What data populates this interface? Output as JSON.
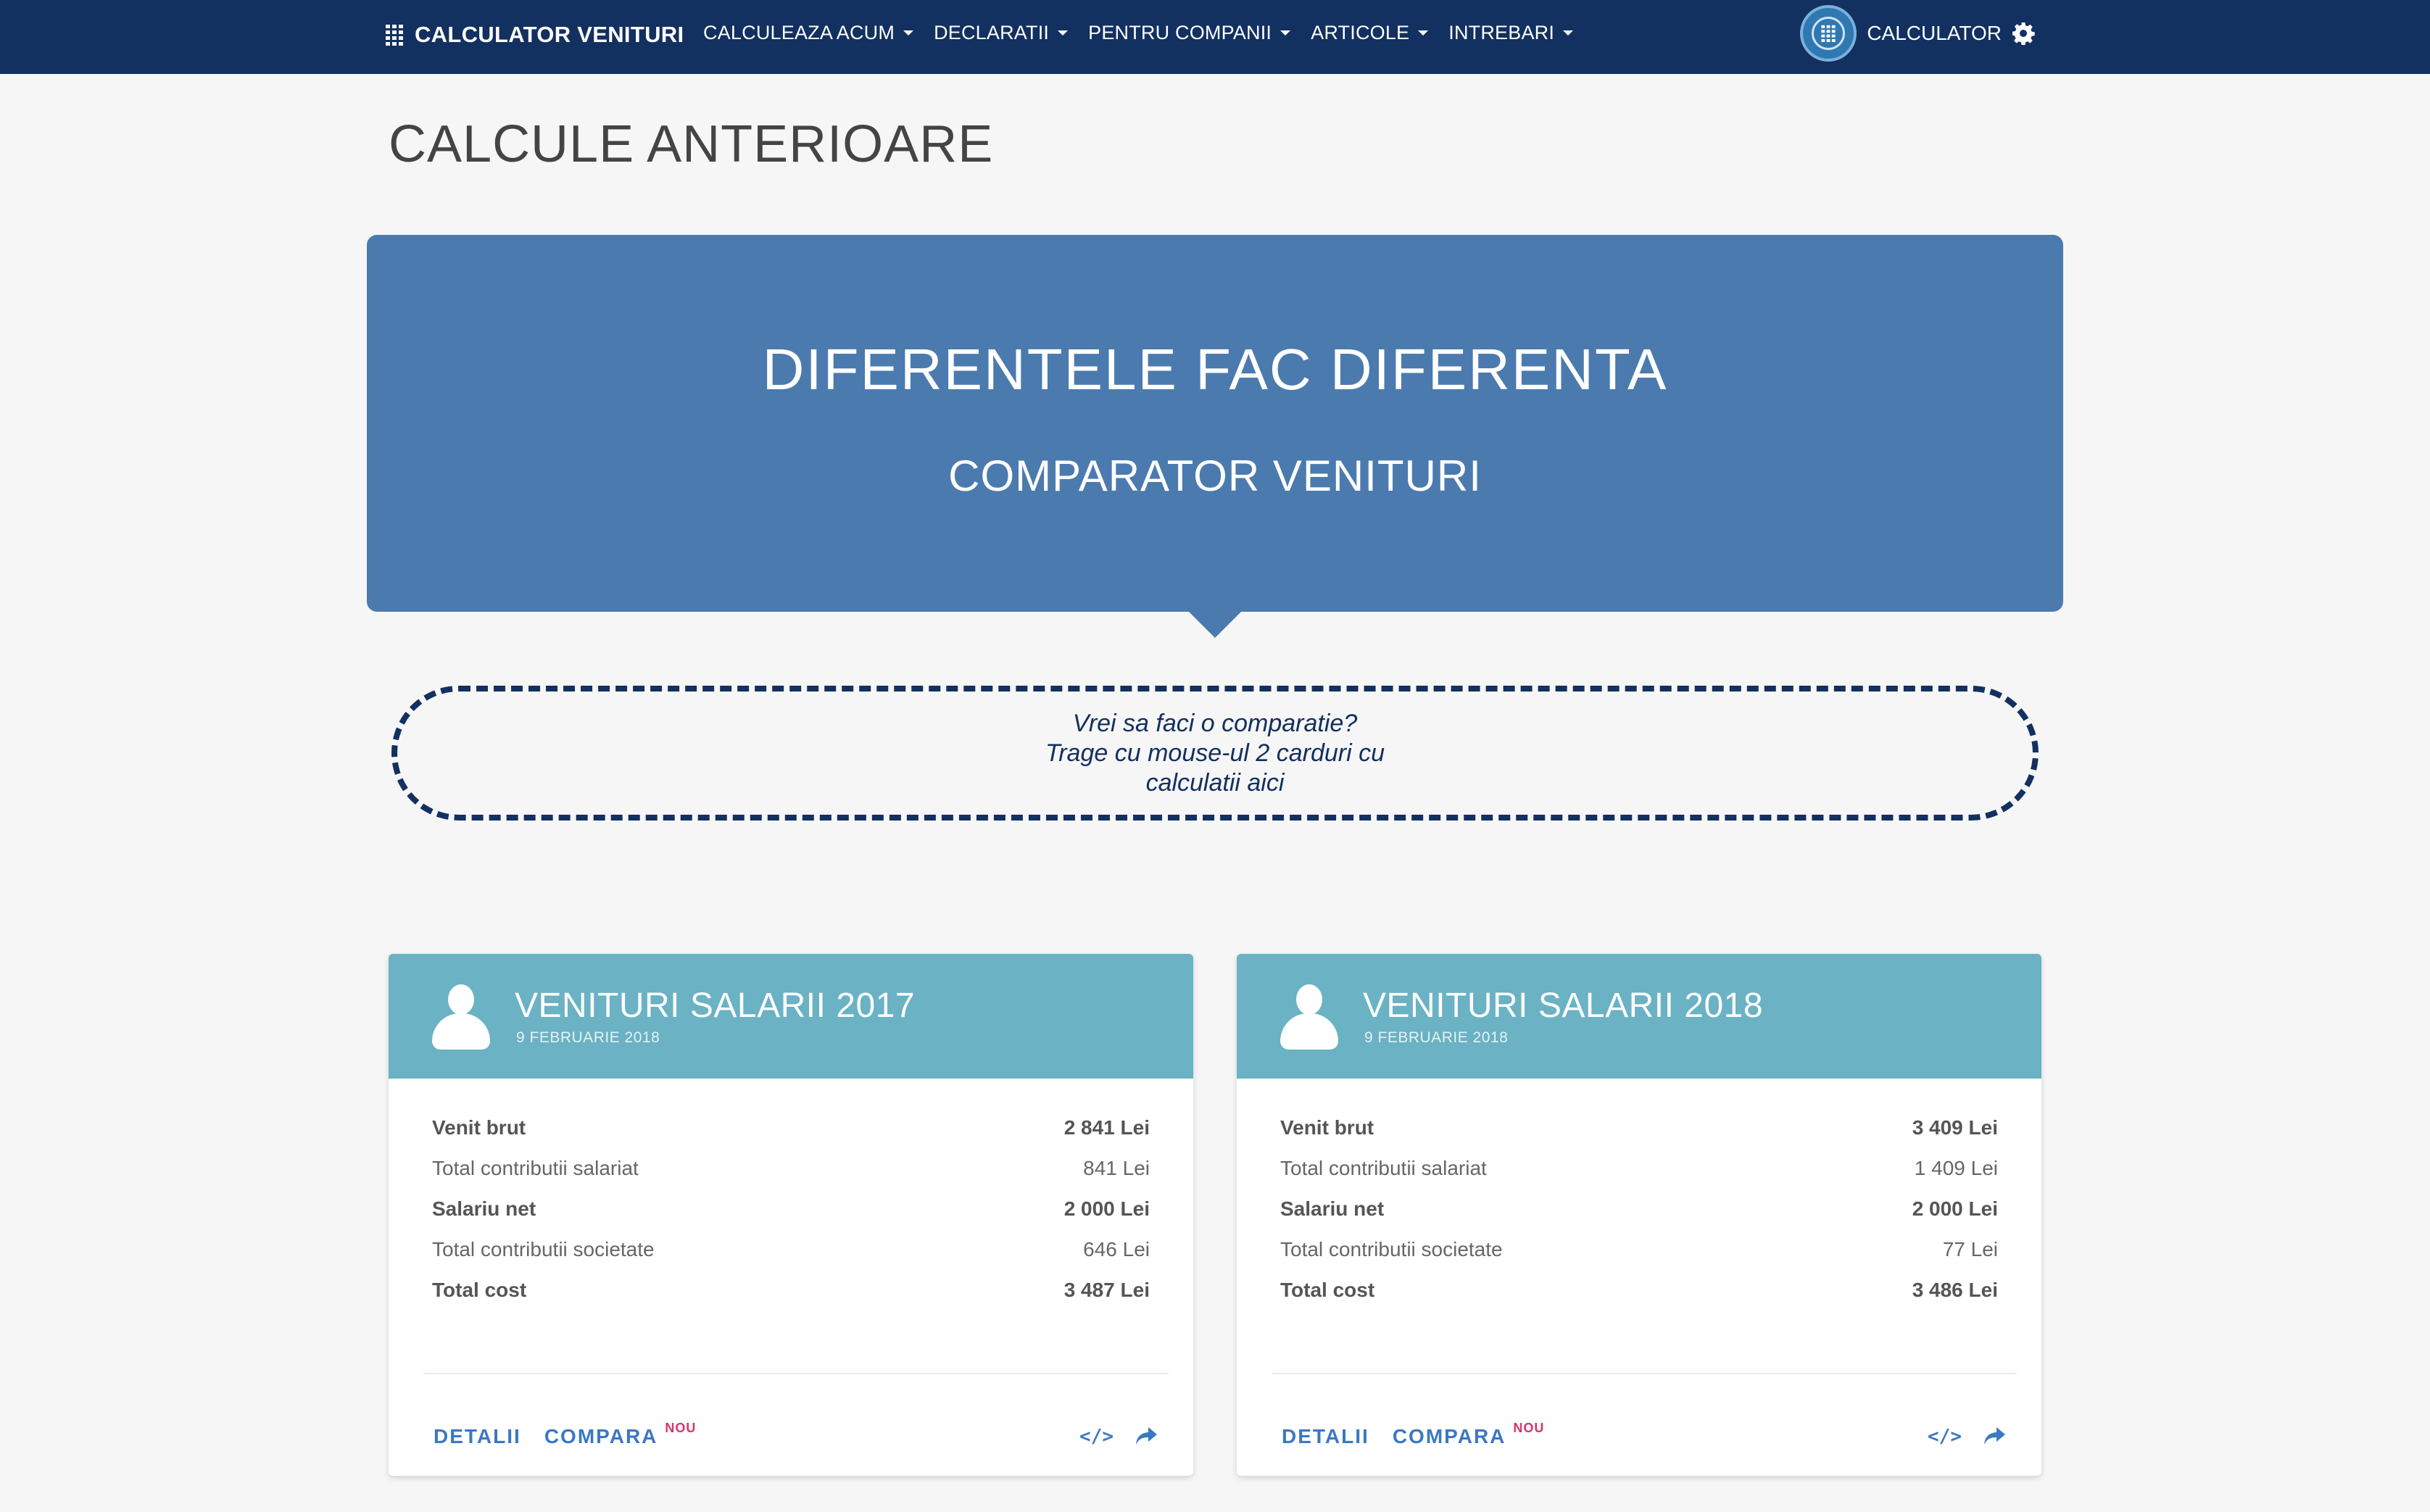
{
  "navbar": {
    "brand": "CALCULATOR VENITURI",
    "items": [
      {
        "label": "CALCULEAZA ACUM"
      },
      {
        "label": "DECLARATII"
      },
      {
        "label": "PENTRU COMPANII"
      },
      {
        "label": "ARTICOLE"
      },
      {
        "label": "INTREBARI"
      }
    ],
    "right_label": "CALCULATOR"
  },
  "page": {
    "title": "CALCULE ANTERIOARE"
  },
  "hero": {
    "title": "DIFERENTELE FAC DIFERENTA",
    "subtitle": "COMPARATOR VENITURI"
  },
  "dropzone": {
    "line1": "Vrei sa faci o comparatie?",
    "line2": "Trage cu mouse-ul 2 carduri cu",
    "line3": "calculatii aici"
  },
  "cards": [
    {
      "title": "VENITURI SALARII 2017",
      "date": "9 FEBRUARIE 2018",
      "rows": [
        {
          "label": "Venit brut",
          "value": "2 841 Lei"
        },
        {
          "label": "Total contributii salariat",
          "value": "841 Lei"
        },
        {
          "label": "Salariu net",
          "value": "2 000 Lei"
        },
        {
          "label": "Total contributii societate",
          "value": "646 Lei"
        },
        {
          "label": "Total cost",
          "value": "3 487 Lei"
        }
      ],
      "details_label": "DETALII",
      "compare_label": "COMPARA",
      "new_badge": "NOU",
      "code_label": "</>"
    },
    {
      "title": "VENITURI SALARII 2018",
      "date": "9 FEBRUARIE 2018",
      "rows": [
        {
          "label": "Venit brut",
          "value": "3 409 Lei"
        },
        {
          "label": "Total contributii salariat",
          "value": "1 409 Lei"
        },
        {
          "label": "Salariu net",
          "value": "2 000 Lei"
        },
        {
          "label": "Total contributii societate",
          "value": "77 Lei"
        },
        {
          "label": "Total cost",
          "value": "3 486 Lei"
        }
      ],
      "details_label": "DETALII",
      "compare_label": "COMPARA",
      "new_badge": "NOU",
      "code_label": "</>"
    }
  ],
  "colors": {
    "navbar": "#123060",
    "hero": "#4b7aae",
    "card_header": "#6ab2c4",
    "link": "#3b78c4",
    "new_badge": "#d9336b"
  },
  "icons": {
    "brand": "calculator-grid-icon",
    "settings": "gear-icon",
    "avatar": "user-icon",
    "share": "share-icon"
  }
}
